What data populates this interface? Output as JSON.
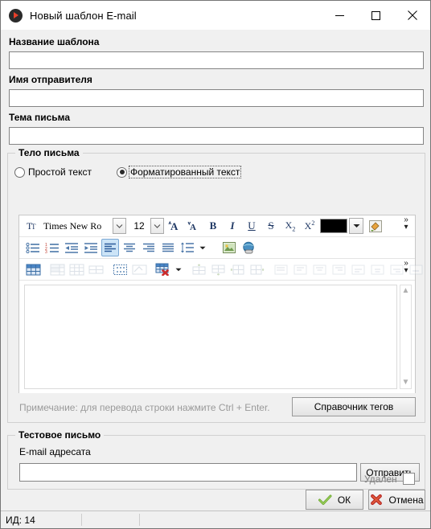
{
  "window": {
    "title": "Новый шаблон E-mail",
    "icon": "app-play-circle-icon",
    "controls": {
      "minimize": "minimize-icon",
      "maximize": "maximize-icon",
      "close": "close-icon"
    }
  },
  "form": {
    "template_name": {
      "label": "Название шаблона",
      "value": "",
      "placeholder": ""
    },
    "sender_name": {
      "label": "Имя отправителя",
      "value": "",
      "placeholder": ""
    },
    "subject": {
      "label": "Тема письма",
      "value": "",
      "placeholder": ""
    }
  },
  "body_group": {
    "title": "Тело письма",
    "radios": [
      {
        "label": "Простой текст",
        "selected": false,
        "focused": false
      },
      {
        "label": "Форматированный текст",
        "selected": true,
        "focused": true
      }
    ]
  },
  "toolbar": {
    "font_name": "Times New Ro",
    "font_size": "12",
    "text_color": "#000000",
    "overflow_label": "»",
    "overflow_arrow": "▾",
    "row1": [
      {
        "name": "font-select-icon",
        "glyph": "T"
      },
      {
        "name": "grow-font-button",
        "glyph": "A"
      },
      {
        "name": "shrink-font-button",
        "glyph": "A"
      },
      {
        "name": "bold-button",
        "glyph": "B"
      },
      {
        "name": "italic-button",
        "glyph": "I"
      },
      {
        "name": "underline-button",
        "glyph": "U"
      },
      {
        "name": "strikethrough-button",
        "glyph": "S"
      },
      {
        "name": "subscript-button",
        "glyph": "X₂"
      },
      {
        "name": "superscript-button",
        "glyph": "X²"
      }
    ],
    "row2": [
      {
        "name": "bullet-list-button"
      },
      {
        "name": "numbered-list-button"
      },
      {
        "name": "decrease-indent-button"
      },
      {
        "name": "increase-indent-button"
      },
      {
        "name": "align-left-button",
        "active": true
      },
      {
        "name": "align-center-button"
      },
      {
        "name": "align-right-button"
      },
      {
        "name": "align-justify-button"
      },
      {
        "name": "line-spacing-button"
      },
      {
        "name": "insert-image-button"
      },
      {
        "name": "insert-hyperlink-button"
      }
    ],
    "row3": [
      {
        "name": "insert-table-button",
        "enabled": true
      },
      {
        "name": "merge-cells-button",
        "enabled": false
      },
      {
        "name": "split-cells-button",
        "enabled": false
      },
      {
        "name": "table-properties-button",
        "enabled": false
      },
      {
        "name": "select-table-button",
        "enabled": true
      },
      {
        "name": "table-borders-button",
        "enabled": false
      },
      {
        "name": "delete-table-button",
        "enabled": true
      },
      {
        "name": "insert-row-above-button",
        "enabled": false
      },
      {
        "name": "insert-row-below-button",
        "enabled": false
      },
      {
        "name": "insert-column-left-button",
        "enabled": false
      },
      {
        "name": "insert-column-right-button",
        "enabled": false
      },
      {
        "name": "delete-column-button",
        "enabled": false
      },
      {
        "name": "cell-align-top-left-button",
        "enabled": false
      },
      {
        "name": "cell-align-top-center-button",
        "enabled": false
      },
      {
        "name": "cell-align-top-right-button",
        "enabled": false
      },
      {
        "name": "cell-align-middle-left-button",
        "enabled": false
      },
      {
        "name": "cell-align-middle-center-button",
        "enabled": false
      },
      {
        "name": "cell-align-middle-right-button",
        "enabled": false
      },
      {
        "name": "cell-align-bottom-left-button",
        "enabled": false
      }
    ]
  },
  "editor": {
    "content": ""
  },
  "note": "Примечание: для перевода строки нажмите Ctrl + Enter.",
  "tags_button": "Справочник тегов",
  "test_group": {
    "title": "Тестовое письмо",
    "email_label": "E-mail адресата",
    "email_value": "",
    "send_button": "Отправить"
  },
  "footer": {
    "deleted_label": "Удален",
    "deleted_checked": false,
    "ok_button": "ОК",
    "cancel_button": "Отмена"
  },
  "statusbar": {
    "id_text": "ИД: 14"
  }
}
